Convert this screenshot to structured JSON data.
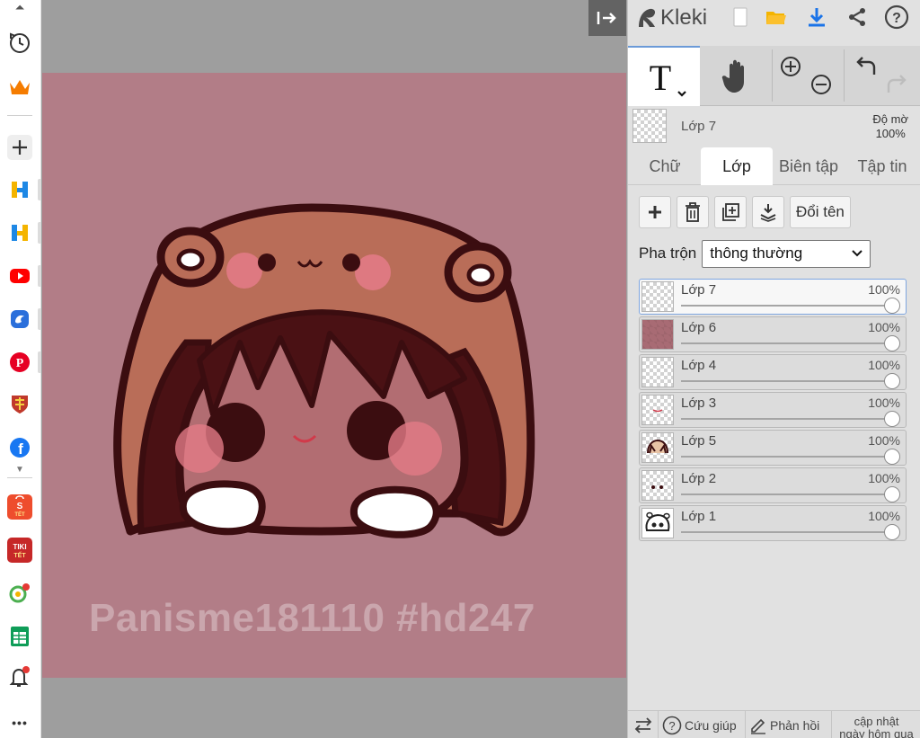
{
  "browser_sidebar": {
    "items": [
      {
        "name": "history-icon"
      },
      {
        "name": "crown-icon",
        "color": "#f57c00"
      },
      {
        "name": "add-icon"
      },
      {
        "name": "h-app-icon",
        "label": "H",
        "color": "#f4b400"
      },
      {
        "name": "h-app-icon-2",
        "label": "H",
        "color": "#1a73e8"
      },
      {
        "name": "youtube-icon",
        "color": "#ff0000"
      },
      {
        "name": "messenger-icon",
        "color": "#1877f2"
      },
      {
        "name": "pinterest-icon",
        "label": "P",
        "color": "#e60023"
      },
      {
        "name": "shield-app-icon",
        "color": "#c0392b"
      },
      {
        "name": "facebook-icon",
        "label": "f",
        "color": "#1877f2"
      },
      {
        "name": "shopee-icon",
        "label": "TẾT",
        "color": "#ee4d2d"
      },
      {
        "name": "tiki-icon",
        "label": "TIKI",
        "color": "#d32f2f"
      },
      {
        "name": "pin-app-icon",
        "color": "#4caf50"
      },
      {
        "name": "sheets-icon",
        "color": "#0f9d58"
      },
      {
        "name": "bell-icon"
      },
      {
        "name": "more-icon",
        "label": "•••"
      }
    ]
  },
  "canvas": {
    "watermark": "Panisme181110 #hd247",
    "background": "#b27d87"
  },
  "panel": {
    "app_name": "Kleki",
    "tabs": [
      "Chữ",
      "Lớp",
      "Biên tập",
      "Tập tin"
    ],
    "active_tab": "Lớp",
    "current_layer": "Lớp 7",
    "opacity_label": "Độ mờ",
    "opacity_value": "100%",
    "actions": {
      "rename": "Đổi tên"
    },
    "blend": {
      "label": "Pha trộn",
      "value": "thông thường"
    },
    "layers": [
      {
        "name": "Lớp 7",
        "opacity": "100%",
        "selected": true
      },
      {
        "name": "Lớp 6",
        "opacity": "100%",
        "selected": false
      },
      {
        "name": "Lớp 4",
        "opacity": "100%",
        "selected": false
      },
      {
        "name": "Lớp 3",
        "opacity": "100%",
        "selected": false
      },
      {
        "name": "Lớp 5",
        "opacity": "100%",
        "selected": false
      },
      {
        "name": "Lớp 2",
        "opacity": "100%",
        "selected": false
      },
      {
        "name": "Lớp 1",
        "opacity": "100%",
        "selected": false
      }
    ],
    "bottom": {
      "help": "Cứu giúp",
      "feedback": "Phản hồi",
      "update_line1": "cập nhật",
      "update_line2": "ngày hôm qua"
    }
  },
  "colors": {
    "accent": "#1a73e8",
    "folder": "#f4b400",
    "panel_bg": "#e1e1e1"
  }
}
